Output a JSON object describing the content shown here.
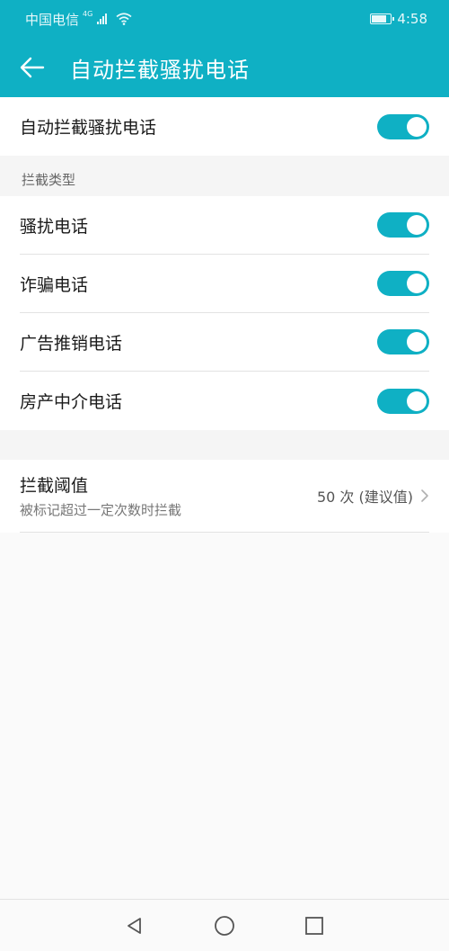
{
  "status_bar": {
    "carrier": "中国电信",
    "network_type": "4G",
    "time": "4:58",
    "battery_level": 0.8
  },
  "app_bar": {
    "title": "自动拦截骚扰电话"
  },
  "main_switch": {
    "label": "自动拦截骚扰电话",
    "enabled": true
  },
  "block_types": {
    "header": "拦截类型",
    "items": [
      {
        "label": "骚扰电话",
        "enabled": true
      },
      {
        "label": "诈骗电话",
        "enabled": true
      },
      {
        "label": "广告推销电话",
        "enabled": true
      },
      {
        "label": "房产中介电话",
        "enabled": true
      }
    ]
  },
  "threshold": {
    "title": "拦截阈值",
    "subtitle": "被标记超过一定次数时拦截",
    "value": "50 次 (建议值)"
  },
  "colors": {
    "accent": "#0fb0c4",
    "background": "#f5f5f5"
  },
  "nav_bar": {
    "icons": [
      "back-triangle-icon",
      "home-circle-icon",
      "recents-square-icon"
    ]
  }
}
